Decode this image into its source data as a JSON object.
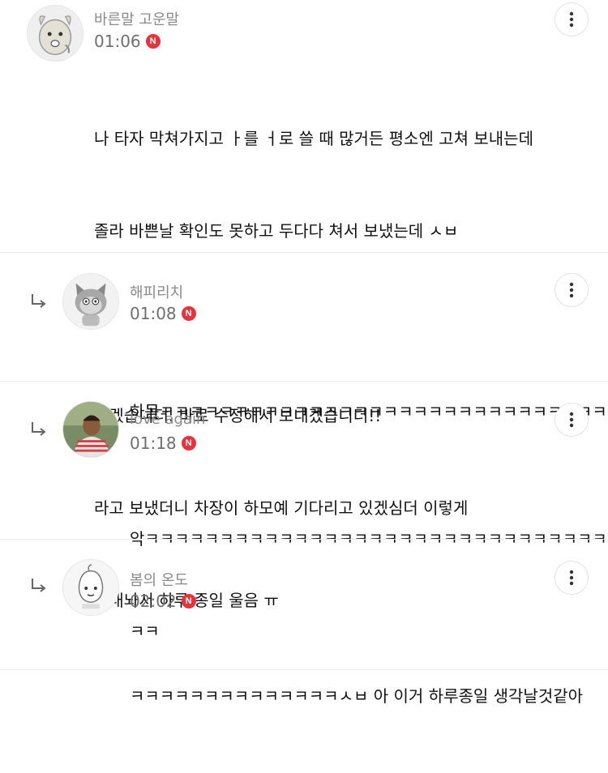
{
  "comments": [
    {
      "nickname": "바른말 고운말",
      "time": "01:06",
      "badge": "N",
      "avatar": "character-avatar-icon",
      "lines": [
        "나 타자 막쳐가지고 ㅏ를 ㅓ로 쓸 때 많거든 평소엔 고쳐 보내는데",
        "졸라 바쁜날 확인도 못하고 두다다 쳐서 보냈는데 ㅅㅂ",
        "",
        "알겠습니더. 바로 수정해서 보내겠습니더!!",
        "라고 보냈더니 차장이 하모예 기다리고 있겠심더 이렇게",
        "보내놔서 하루 종일 울음 ㅠ"
      ]
    },
    {
      "nickname": "해피리치",
      "time": "01:08",
      "badge": "N",
      "avatar": "cat-avatar-icon",
      "lines": [
        "하몯ㅋㅋㅋㅋㅋㅋㅋㅋㅋㅋㅋㅋㅋㅋㅋㅋㅋㅋㅋㅋㅋㅋㅋㅋㅋㅋㅋㅋㅋㅋㅋ"
      ]
    },
    {
      "nickname": "love again",
      "time": "01:18",
      "badge": "N",
      "avatar": "photo-avatar-icon",
      "lines": [
        "악ㅋㅋㅋㅋㅋㅋㅋㅋㅋㅋㅋㅋㅋㅋㅋㅋㅋㅋㅋㅋㅋㅋㅋㅋㅋㅋㅋㅋㅋㅋㅋㅋㅋ",
        "ㅋㅋ"
      ]
    },
    {
      "nickname": "봄의 온도",
      "time": "02:02",
      "badge": "N",
      "avatar": "peach-avatar-icon",
      "lines": [
        "ㅋㅋㅋㅋㅋㅋㅋㅋㅋㅋㅋㅋㅋㅋㅅㅂ 아 이거 하루종일 생각날것같아"
      ]
    }
  ],
  "colors": {
    "badge": "#e8323c",
    "nickname": "#8a8a8a",
    "time": "#6f6f6f"
  }
}
